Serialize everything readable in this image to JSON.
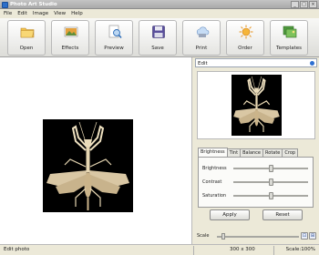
{
  "window": {
    "title": "Photo Art Studio",
    "minimize": "_",
    "maximize": "□",
    "close": "×"
  },
  "menu": [
    "File",
    "Edit",
    "Image",
    "View",
    "Help"
  ],
  "toolbar": [
    {
      "label": "Open",
      "icon": "folder-icon"
    },
    {
      "label": "Effects",
      "icon": "effects-icon"
    },
    {
      "label": "Preview",
      "icon": "preview-icon"
    },
    {
      "label": "Save",
      "icon": "save-icon"
    },
    {
      "label": "Print",
      "icon": "print-icon"
    },
    {
      "label": "Order",
      "icon": "order-icon"
    },
    {
      "label": "Templates",
      "icon": "templates-icon"
    }
  ],
  "panel": {
    "title": "Edit",
    "tabs": [
      "Brightness",
      "Tint",
      "Balance",
      "Rotate",
      "Crop"
    ],
    "active_tab": "Brightness",
    "sliders": [
      {
        "label": "Brightness",
        "value": 0.5
      },
      {
        "label": "Contrast",
        "value": 0.5
      },
      {
        "label": "Saturation",
        "value": 0.5
      }
    ],
    "apply": "Apply",
    "reset": "Reset",
    "scale_label": "Scale",
    "scale_value": 0.05
  },
  "status": {
    "left": "Edit photo",
    "middle": "300 x 300",
    "right": "Scale:100%"
  },
  "colors": {
    "accent": "#2d6fd1",
    "canvas": "#ffffff",
    "photo_bg": "#000000"
  }
}
